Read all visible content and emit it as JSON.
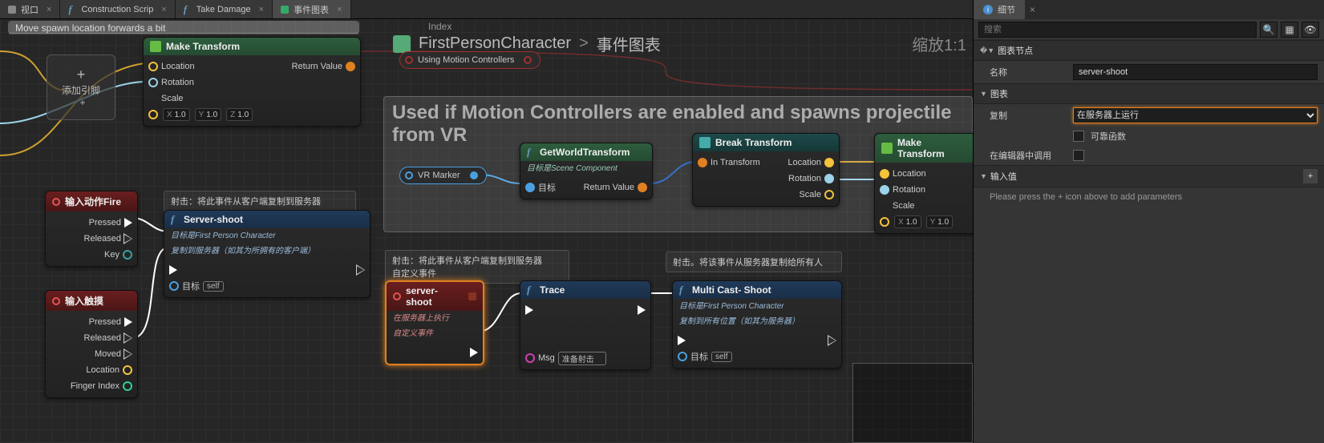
{
  "tabs": [
    {
      "label": "视口",
      "icon": "viewport"
    },
    {
      "label": "Construction Scrip",
      "icon": "f"
    },
    {
      "label": "Take Damage",
      "icon": "f"
    },
    {
      "label": "事件图表",
      "icon": "graph",
      "active": true
    }
  ],
  "breadcrumb": {
    "index": "Index",
    "parent": "FirstPersonCharacter",
    "sep": ">",
    "current": "事件图表"
  },
  "zoom": "缩放1:1",
  "comments": {
    "c0": "Move spawn location forwards a bit",
    "c_big": "Used if Motion Controllers are enabled and spawns projectile from VR"
  },
  "tips": {
    "t1": "射击：将此事件从客户端复制到服务器",
    "t2": "射击：将此事件从客户端复制到服务器\n自定义事件",
    "t3": "射击。将该事件从服务器复制给所有人"
  },
  "pill": {
    "label": "Using Motion Controllers"
  },
  "addpin": {
    "label": "添加引脚",
    "plus": "+"
  },
  "nodes": {
    "makeT": {
      "title": "Make Transform",
      "pins": {
        "loc": "Location",
        "rot": "Rotation",
        "scale": "Scale",
        "ret": "Return Value"
      },
      "vals": {
        "x": "1.0",
        "y": "1.0",
        "z": "1.0"
      }
    },
    "inputFire": {
      "title": "输入动作Fire",
      "pins": {
        "pressed": "Pressed",
        "released": "Released",
        "key": "Key"
      }
    },
    "inputTouch": {
      "title": "输入触摸",
      "pins": {
        "pressed": "Pressed",
        "released": "Released",
        "moved": "Moved",
        "loc": "Location",
        "idx": "Finger Index"
      }
    },
    "serverShoot": {
      "title": "Server-shoot",
      "sub1": "目标是First Person Character",
      "sub2": "复制到服务器（如其为所拥有的客户端）",
      "pins": {
        "target": "目标",
        "self": "self"
      }
    },
    "serverShootEvt": {
      "title": "server-shoot",
      "sub1": "在服务器上执行",
      "sub2": "自定义事件"
    },
    "trace": {
      "title": "Trace",
      "pins": {
        "msg": "Msg",
        "msgval": "准备射击"
      }
    },
    "multicast": {
      "title": "Multi Cast- Shoot",
      "sub1": "目标是First Person Character",
      "sub2": "复制到所有位置（如其为服务器）",
      "pins": {
        "target": "目标",
        "self": "self"
      }
    },
    "getWT": {
      "title": "GetWorldTransform",
      "sub": "目标是Scene Component",
      "pins": {
        "target": "目标",
        "ret": "Return Value"
      }
    },
    "vrmarker": {
      "label": "VR Marker"
    },
    "breakT": {
      "title": "Break Transform",
      "pins": {
        "in": "In Transform",
        "loc": "Location",
        "rot": "Rotation",
        "scale": "Scale"
      }
    },
    "makeT2": {
      "title": "Make Transform",
      "pins": {
        "loc": "Location",
        "rot": "Rotation",
        "scale": "Scale"
      },
      "vals": {
        "x": "1.0",
        "y": "1.0"
      }
    }
  },
  "details": {
    "title": "细节",
    "search_ph": "搜索",
    "cat_graphnode": "图表节点",
    "name_lbl": "名称",
    "name_val": "server-shoot",
    "cat_graph": "图表",
    "repl_lbl": "复制",
    "repl_val": "在服务器上运行",
    "reliable_lbl": "可靠函数",
    "calleditor_lbl": "在编辑器中调用",
    "cat_inputs": "输入值",
    "inputs_hint": "Please press the + icon above to add parameters"
  }
}
